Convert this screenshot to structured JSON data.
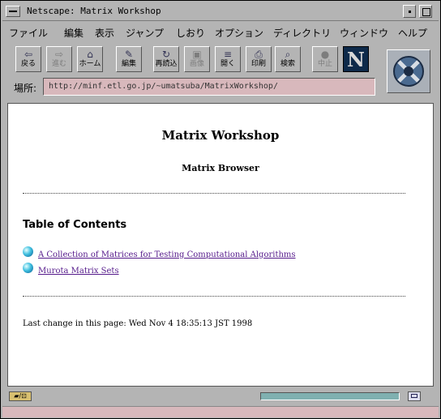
{
  "window": {
    "title": "Netscape: Matrix Workshop"
  },
  "menu": [
    "ファイル",
    "編集",
    "表示",
    "ジャンプ",
    "しおり",
    "オプション",
    "ディレクトリ",
    "ウィンドウ",
    "ヘルプ"
  ],
  "toolbar": {
    "buttons": [
      {
        "label": "戻る",
        "icon": "back-icon",
        "glyph": "⇦",
        "enabled": true
      },
      {
        "label": "進む",
        "icon": "forward-icon",
        "glyph": "⇨",
        "enabled": false
      },
      {
        "label": "ホーム",
        "icon": "home-icon",
        "glyph": "⌂",
        "enabled": true
      },
      {
        "label": "編集",
        "icon": "edit-icon",
        "glyph": "✎",
        "enabled": true
      },
      {
        "label": "再読込",
        "icon": "reload-icon",
        "glyph": "↻",
        "enabled": true
      },
      {
        "label": "画像",
        "icon": "images-icon",
        "glyph": "▣",
        "enabled": false
      },
      {
        "label": "開く",
        "icon": "open-icon",
        "glyph": "≡",
        "enabled": true
      },
      {
        "label": "印刷",
        "icon": "print-icon",
        "glyph": "⎙",
        "enabled": true
      },
      {
        "label": "検索",
        "icon": "find-icon",
        "glyph": "⌕",
        "enabled": true
      },
      {
        "label": "中止",
        "icon": "stop-icon",
        "glyph": "●",
        "enabled": false
      }
    ],
    "logo_letter": "N"
  },
  "location": {
    "label": "場所:",
    "url": "http://minf.etl.go.jp/~umatsuba/MatrixWorkshop/"
  },
  "page": {
    "heading": "Matrix Workshop",
    "subheading": "Matrix Browser",
    "toc_heading": "Table of Contents",
    "links": [
      "A Collection of Matrices for Testing Computational Algorithms",
      "Murota Matrix Sets"
    ],
    "last_change": "Last change in this page: Wed Nov 4 18:35:13 JST 1998"
  },
  "status": {
    "icon_text": "▰/⊡"
  }
}
